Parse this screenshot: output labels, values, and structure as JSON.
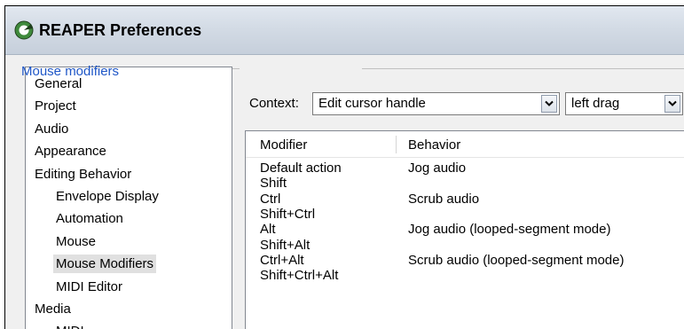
{
  "window": {
    "title": "REAPER Preferences"
  },
  "nav": {
    "items": [
      {
        "label": "General",
        "indent": 0
      },
      {
        "label": "Project",
        "indent": 0
      },
      {
        "label": "Audio",
        "indent": 0
      },
      {
        "label": "Appearance",
        "indent": 0
      },
      {
        "label": "Editing Behavior",
        "indent": 0
      },
      {
        "label": "Envelope Display",
        "indent": 1
      },
      {
        "label": "Automation",
        "indent": 1
      },
      {
        "label": "Mouse",
        "indent": 1
      },
      {
        "label": "Mouse Modifiers",
        "indent": 1,
        "selected": true
      },
      {
        "label": "MIDI Editor",
        "indent": 1
      },
      {
        "label": "Media",
        "indent": 0
      },
      {
        "label": "MIDI",
        "indent": 1
      }
    ]
  },
  "group": {
    "label": "Mouse modifiers"
  },
  "context": {
    "label": "Context:",
    "context_value": "Edit cursor handle",
    "action_value": "left drag"
  },
  "table": {
    "headers": {
      "modifier": "Modifier",
      "behavior": "Behavior"
    },
    "rows": [
      {
        "modifier": "Default action",
        "behavior": "Jog audio"
      },
      {
        "modifier": "Shift",
        "behavior": ""
      },
      {
        "modifier": "Ctrl",
        "behavior": "Scrub audio"
      },
      {
        "modifier": "Shift+Ctrl",
        "behavior": ""
      },
      {
        "modifier": "Alt",
        "behavior": "Jog audio (looped-segment mode)"
      },
      {
        "modifier": "Shift+Alt",
        "behavior": ""
      },
      {
        "modifier": "Ctrl+Alt",
        "behavior": "Scrub audio (looped-segment mode)"
      },
      {
        "modifier": "Shift+Ctrl+Alt",
        "behavior": ""
      }
    ]
  },
  "colors": {
    "group_label": "#1e56c7",
    "selection_bg": "#e0e0e0",
    "icon_green": "#3f8a3c"
  },
  "icons": {
    "app": "reaper-logo-icon",
    "dropdown": "chevron-down-icon"
  }
}
